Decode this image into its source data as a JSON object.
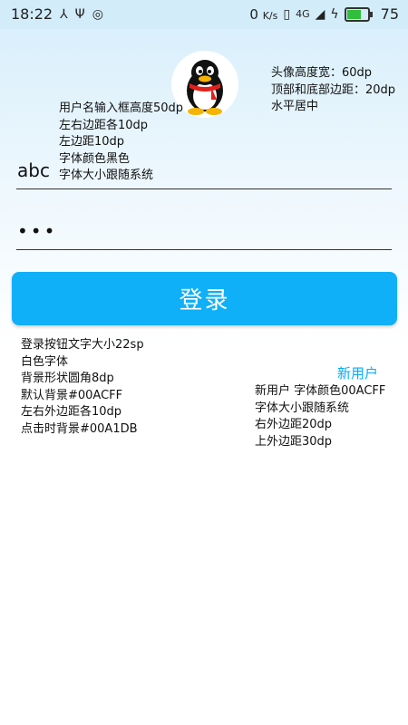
{
  "status_bar": {
    "time": "18:22",
    "left_icons": [
      "share-icon",
      "usb-icon",
      "wifi-hotspot-icon"
    ],
    "net_speed": "0",
    "net_speed_unit": "K/s",
    "signal_label": "4G",
    "battery_percent": "75",
    "battery_level": 0.75
  },
  "avatar_notes": [
    "头像高度宽：60dp",
    "顶部和底部边距：20dp",
    "水平居中"
  ],
  "username_notes": [
    "用户名输入框高度50dp",
    "左右边距各10dp",
    "左边距10dp",
    "字体颜色黑色",
    "字体大小跟随系统"
  ],
  "username": {
    "value": "abc"
  },
  "password": {
    "value": "•••"
  },
  "login_button": {
    "label": "登录",
    "color": "#0FB0F8"
  },
  "login_notes": [
    "登录按钮文字大小22sp",
    "白色字体",
    "背景形状圆角8dp",
    "默认背景#00ACFF",
    "左右外边距各10dp",
    "点击时背景#00A1DB"
  ],
  "new_user": {
    "label": "新用户",
    "color": "#00ACFF"
  },
  "new_user_notes": [
    "新用户 字体颜色00ACFF",
    "字体大小跟随系统",
    "右外边距20dp",
    "上外边距30dp"
  ]
}
